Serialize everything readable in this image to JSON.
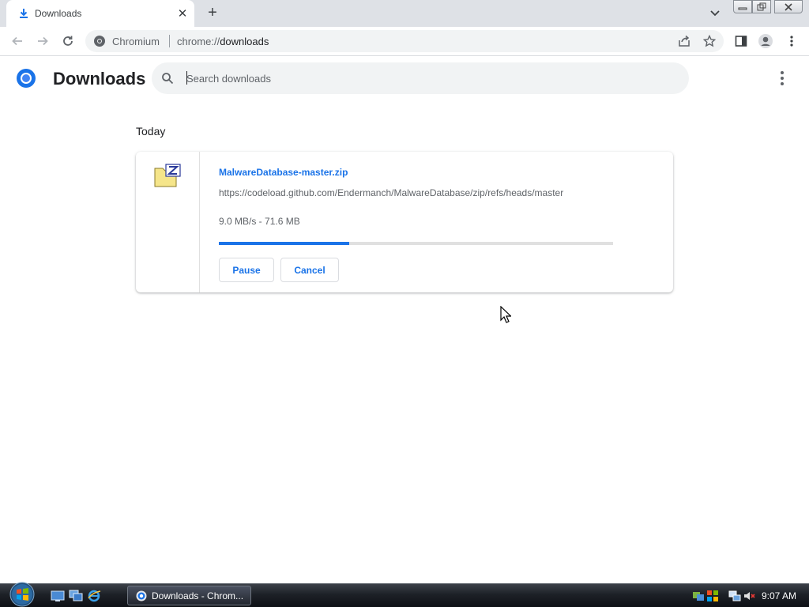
{
  "colors": {
    "accent": "#1a73e8",
    "tabstrip": "#dee1e6",
    "omnibox": "#f1f3f4"
  },
  "tab": {
    "title": "Downloads",
    "icon": "download-icon",
    "close_label": "✕"
  },
  "newtab_label": "+",
  "toolbar": {
    "site_name": "Chromium",
    "url_scheme": "chrome://",
    "url_host": "downloads"
  },
  "page": {
    "title": "Downloads",
    "search_placeholder": "Search downloads"
  },
  "downloads": {
    "date_heading": "Today",
    "items": [
      {
        "file_name": "MalwareDatabase-master.zip",
        "url": "https://codeload.github.com/Endermanch/MalwareDatabase/zip/refs/heads/master",
        "status": "9.0 MB/s - 71.6 MB",
        "progress": 0.33,
        "pause_label": "Pause",
        "cancel_label": "Cancel"
      }
    ]
  },
  "taskbar": {
    "task_title": "Downloads - Chrom...",
    "clock": "9:07 AM"
  }
}
